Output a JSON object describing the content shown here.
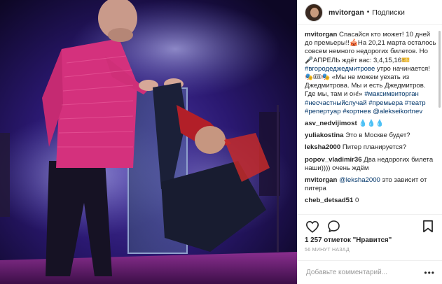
{
  "post": {
    "username": "mvitorgan",
    "follow_label": "Подписки",
    "caption": {
      "user": "mvitorgan",
      "text_a": " Спасайся кто может! 10 дней до премьеры!!🎪На 20,21 марта осталось совсем немного недорогих билетов. Но 🎤АПРЕЛЬ ждёт вас: 3,4,15,16🎫 ",
      "tag_a": "#вгородеджедмитрове",
      "text_b": " утро начинается! 🎭🎟🎭 «Мы не можем уехать из Джедмитрова. Мы и есть Джедмитров. Где мы, там и он!» ",
      "tags_b": "#максимвиторган #несчастныйслучай #премьера #театр #репертуар #кортнев @alekseikortnev"
    },
    "comments": [
      {
        "user": "asv_nedvijimost",
        "text": " 💧💧💧",
        "mention": "",
        "rest": ""
      },
      {
        "user": "yuliakostina",
        "text": " Это в Москве будет?",
        "mention": "",
        "rest": ""
      },
      {
        "user": "leksha2000",
        "text": " Питер планируется?",
        "mention": "",
        "rest": ""
      },
      {
        "user": "popov_vladimir36",
        "text": " Два недорогих билета наши)))) очень ждём",
        "mention": "",
        "rest": ""
      },
      {
        "user": "mvitorgan",
        "text": " ",
        "mention": "@leksha2000",
        "rest": " это зависит от питера"
      },
      {
        "user": "cheb_detsad51",
        "text": " 0",
        "mention": "",
        "rest": ""
      }
    ],
    "likes": "1 257 отметок \"Нравится\"",
    "time_ago": "56 МИНУТ НАЗАД",
    "comment_placeholder": "Добавьте комментарий...",
    "more_label": "•••"
  },
  "icons": [
    "heart-icon",
    "comment-icon",
    "bookmark-icon"
  ]
}
